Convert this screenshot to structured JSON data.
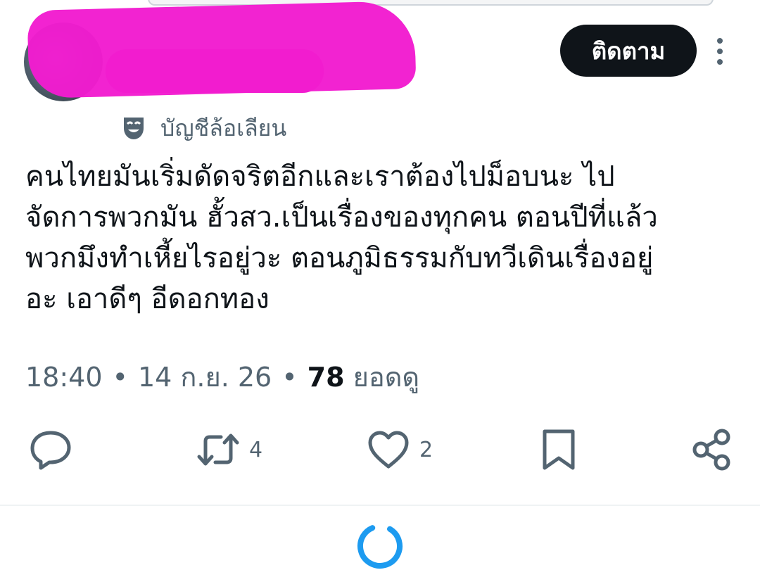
{
  "header": {
    "display_name": "",
    "handle": "@",
    "follow_label": "ติดตาม"
  },
  "account_label": "บัญชีล้อเลียน",
  "tweet": {
    "lines": [
      "คนไทยมันเริ่มดัดจริตอีกและเราต้องไปม็อบนะ ไป",
      "จัดการพวกมัน ฮั้วสว.เป็นเรื่องของทุกคน ตอนปีที่แล้ว",
      "พวกมึงทำเหี้ยไรอยู่วะ ตอนภูมิธรรมกับทวีเดินเรื่องอยู่",
      "อะ เอาดีๆ อีดอกทอง"
    ]
  },
  "meta": {
    "time": "18:40",
    "date": "14 ก.ย. 26",
    "views_count": "78",
    "views_label": "ยอดดู",
    "separator": "•"
  },
  "actions": {
    "replies": "",
    "reposts": "4",
    "likes": "2"
  },
  "colors": {
    "text": "#0f1419",
    "secondary": "#536471",
    "spinner": "#1d9bf0",
    "redaction": "#f21ccf"
  },
  "icons": [
    "vertical-dots-icon",
    "parody-mask-icon",
    "reply-icon",
    "repost-icon",
    "like-icon",
    "bookmark-icon",
    "share-icon",
    "loading-spinner-icon"
  ]
}
